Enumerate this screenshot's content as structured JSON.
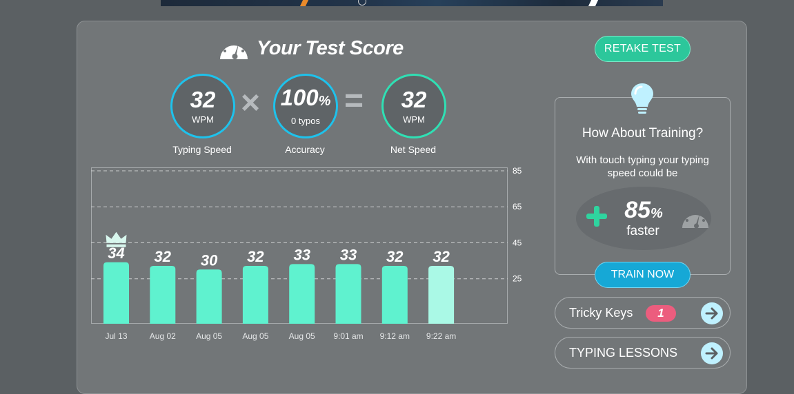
{
  "header": {
    "title": "Your Test Score"
  },
  "stats": {
    "typing_speed": {
      "value": "32",
      "unit": "WPM",
      "label": "Typing Speed"
    },
    "accuracy": {
      "value": "100",
      "percent_sign": "%",
      "unit": "0 typos",
      "label": "Accuracy"
    },
    "net_speed": {
      "value": "32",
      "unit": "WPM",
      "label": "Net Speed"
    },
    "multiply_symbol": "×",
    "equals_symbol": "="
  },
  "buttons": {
    "retake": "RETAKE TEST",
    "train_now": "TRAIN NOW"
  },
  "training": {
    "title": "How About Training?",
    "description": "With touch typing your typing speed could be",
    "improvement": "85",
    "percent_sign": "%",
    "faster_label": "faster"
  },
  "links": {
    "tricky_keys": {
      "label": "Tricky Keys",
      "count": "1"
    },
    "typing_lessons": {
      "label": "TYPING LESSONS"
    }
  },
  "colors": {
    "bar": "#5ff2cf",
    "bar_latest": "#aaf9e6",
    "accent_blue": "#1ec2ec",
    "accent_green": "#2fe0b4"
  },
  "icons": [
    "speedometer-icon",
    "lightbulb-icon",
    "plus-icon",
    "crown-icon",
    "arrow-right-icon"
  ],
  "chart_data": {
    "type": "bar",
    "categories": [
      "Jul 13",
      "Aug 02",
      "Aug 05",
      "Aug 05",
      "Aug 05",
      "9:01 am",
      "9:12 am",
      "9:22 am"
    ],
    "values": [
      34,
      32,
      30,
      32,
      33,
      33,
      32,
      32
    ],
    "value_labels": [
      "34",
      "32",
      "30",
      "32",
      "33",
      "33",
      "32",
      "32"
    ],
    "yticks": [
      25,
      45,
      65,
      85
    ],
    "ytick_labels": [
      "25",
      "45",
      "65",
      "85"
    ],
    "ylim": [
      0,
      85
    ],
    "grid": "dashed",
    "best_marker": "crown on highest bar"
  }
}
